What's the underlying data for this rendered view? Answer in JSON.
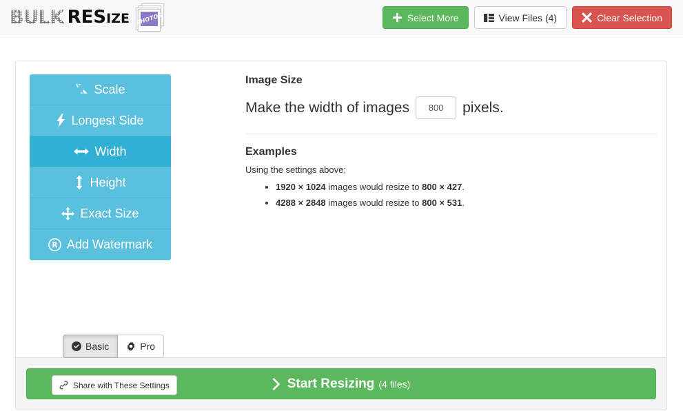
{
  "header": {
    "logo": {
      "bulk": "BULK",
      "resize_main": "RES",
      "resize_small": "IZE",
      "photos_badge": "PHOTOS"
    },
    "buttons": [
      {
        "label": "Select More",
        "icon": "plus-icon",
        "style": "success"
      },
      {
        "label": "View Files (4)",
        "icon": "columns-icon",
        "style": "default"
      },
      {
        "label": "Clear Selection",
        "icon": "times-icon",
        "style": "danger"
      }
    ]
  },
  "sidebar": {
    "tabs": [
      {
        "label": "Scale",
        "icon": "compress-arrows-icon",
        "active": false
      },
      {
        "label": "Longest Side",
        "icon": "bolt-icon",
        "active": false
      },
      {
        "label": "Width",
        "icon": "arrows-horizontal-icon",
        "active": true
      },
      {
        "label": "Height",
        "icon": "arrows-vertical-icon",
        "active": false
      },
      {
        "label": "Exact Size",
        "icon": "arrows-move-icon",
        "active": false
      },
      {
        "label": "Add Watermark",
        "icon": "registered-icon",
        "active": false
      }
    ],
    "modes": [
      {
        "label": "Basic",
        "icon": "check-circle-icon",
        "active": true
      },
      {
        "label": "Pro",
        "icon": "gear-icon",
        "active": false
      }
    ],
    "share_label": "Share with These Settings",
    "share_icon": "link-icon"
  },
  "content": {
    "image_size_title": "Image Size",
    "size_prefix": "Make the width of images",
    "size_suffix": "pixels.",
    "width_value": "800",
    "width_placeholder": "800",
    "examples_title": "Examples",
    "examples_sub": "Using the settings above;",
    "examples": [
      {
        "source": "1920 × 1024",
        "mid": "images would resize to",
        "result": "800 × 427",
        "end": "."
      },
      {
        "source": "4288 × 2848",
        "mid": "images would resize to",
        "result": "800 × 531",
        "end": "."
      }
    ]
  },
  "footer": {
    "start_label": "Start Resizing",
    "start_count": "(4 files)",
    "start_icon": "chevron-right-icon"
  },
  "colors": {
    "info": "#5bc0de",
    "info_active": "#31b0d5",
    "success": "#5cb85c",
    "danger": "#d9534f",
    "panel_border": "#dddddd",
    "footer_bg": "#f5f5f5",
    "header_bg": "#f8f8f8"
  }
}
